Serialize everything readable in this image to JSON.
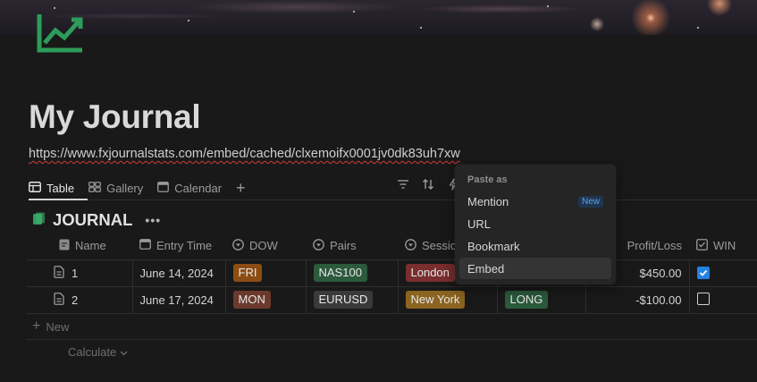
{
  "page": {
    "title": "My Journal",
    "pasted_url": "https://www.fxjournalstats.com/embed/cached/clxemoifx0001jv0dk83uh7xw",
    "icon": "trend-chart-icon",
    "accent_color": "#2e9c5a"
  },
  "views": {
    "tabs": [
      {
        "label": "Table",
        "icon": "table-icon"
      },
      {
        "label": "Gallery",
        "icon": "gallery-icon"
      },
      {
        "label": "Calendar",
        "icon": "calendar-icon"
      }
    ],
    "add_icon": "plus-icon"
  },
  "database": {
    "title": "JOURNAL",
    "columns": [
      {
        "label": "Name",
        "icon": "doc-icon"
      },
      {
        "label": "Entry Time",
        "icon": "calendar-icon"
      },
      {
        "label": "DOW",
        "icon": "select-icon"
      },
      {
        "label": "Pairs",
        "icon": "select-icon"
      },
      {
        "label": "Sessio",
        "icon": "select-icon"
      },
      {
        "label": "",
        "icon": ""
      },
      {
        "label": "Profit/Loss",
        "icon": ""
      },
      {
        "label": "WIN",
        "icon": "checkbox-icon"
      }
    ],
    "rows": [
      {
        "name": "1",
        "entry_time": "June 14, 2024",
        "dow": "FRI",
        "pair": "NAS100",
        "session": "London",
        "direction": "",
        "profit_loss": "$450.00",
        "win": true
      },
      {
        "name": "2",
        "entry_time": "June 17, 2024",
        "dow": "MON",
        "pair": "EURUSD",
        "session": "New York",
        "direction": "LONG",
        "profit_loss": "-$100.00",
        "win": false
      }
    ],
    "new_label": "New",
    "calculate_label": "Calculate"
  },
  "paste_menu": {
    "header": "Paste as",
    "items": [
      {
        "label": "Mention",
        "badge": "New"
      },
      {
        "label": "URL"
      },
      {
        "label": "Bookmark"
      },
      {
        "label": "Embed"
      }
    ],
    "hovered": "Embed"
  },
  "tag_colors": {
    "fri": "#8c4d15",
    "mon": "#6b3a2c",
    "nas100": "#2b5a3c",
    "eurusd": "#3a3a3a",
    "london": "#7a2e2e",
    "new_york": "#8a6420",
    "long": "#2b5a3c"
  }
}
